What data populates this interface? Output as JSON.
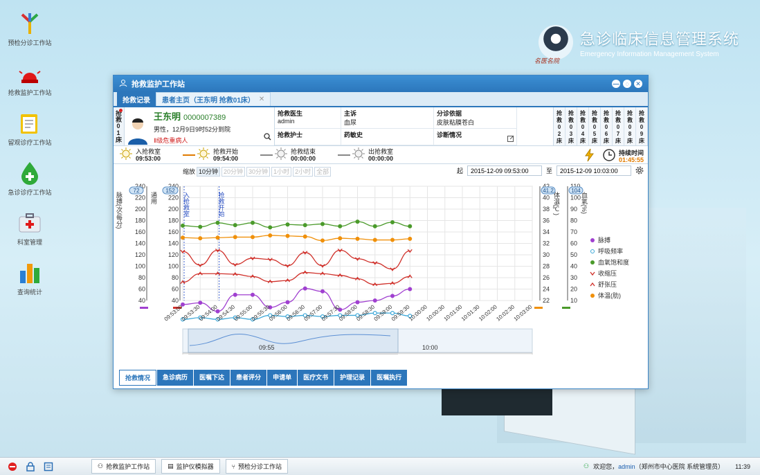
{
  "desktop": {
    "icons": [
      {
        "label": "预检分诊工作站",
        "icon": "triage-arrows-icon"
      },
      {
        "label": "抢救监护工作站",
        "icon": "alarm-light-icon"
      },
      {
        "label": "留观诊疗工作站",
        "icon": "clipboard-icon"
      },
      {
        "label": "急诊诊疗工作站",
        "icon": "drop-cross-icon"
      },
      {
        "label": "科室管理",
        "icon": "medkit-icon"
      },
      {
        "label": "查询统计",
        "icon": "bar-chart-icon"
      }
    ]
  },
  "brand": {
    "title": "急诊临床信息管理系统",
    "subtitle": "Emergency Information Management System",
    "logo_caption": "名医名院"
  },
  "window": {
    "title": "抢救监护工作站",
    "tabs": [
      {
        "label": "抢救记录",
        "active": true
      },
      {
        "label": "患者主页（王东明 抢救01床）",
        "active": false
      }
    ],
    "patient": {
      "bed_label": "抢救01床",
      "name": "王东明",
      "number": "0000007389",
      "info": "男性，12月9日9时52分到院",
      "critical": "Ⅱ级危重病人",
      "fields": [
        {
          "label": "抢救医生",
          "value": "admin"
        },
        {
          "label": "主诉",
          "value": "血尿"
        },
        {
          "label": "分诊依据",
          "value": "皮肤粘膜苍白"
        },
        {
          "label": "抢救护士",
          "value": ""
        },
        {
          "label": "药敏史",
          "value": ""
        },
        {
          "label": "诊断情况",
          "value": ""
        }
      ],
      "other_beds": [
        "抢救02床",
        "抢救03床",
        "抢救04床",
        "抢救05床",
        "抢救06床",
        "抢救07床",
        "抢救08床",
        "抢救09床"
      ]
    },
    "flow": [
      {
        "label": "入抢救室",
        "time": "09:53:00"
      },
      {
        "label": "抢救开始",
        "time": "09:54:00"
      },
      {
        "label": "抢救结束",
        "time": "00:00:00"
      },
      {
        "label": "出抢救室",
        "time": "00:00:00"
      }
    ],
    "duration": {
      "label": "持续时间",
      "value": "01:45:55"
    },
    "zoom": {
      "label": "缩放",
      "options": [
        "10分钟",
        "20分钟",
        "30分钟",
        "1小时",
        "2小时",
        "全部"
      ],
      "active": "10分钟"
    },
    "range": {
      "from_label": "起",
      "from": "2015-12-09 09:53:00",
      "to_label": "至",
      "to": "2015-12-09 10:03:00"
    },
    "bottom_tabs": [
      "抢救情况",
      "急诊病历",
      "医嘱下达",
      "患者评分",
      "申请单",
      "医疗文书",
      "护理记录",
      "医嘱执行"
    ],
    "bottom_active": "抢救情况"
  },
  "chart_data": {
    "type": "line",
    "x": [
      "09:53:00",
      "09:53:30",
      "09:54:00",
      "09:54:30",
      "09:55:00",
      "09:55:30",
      "09:56:00",
      "09:56:30",
      "09:57:00",
      "09:57:30",
      "09:58:00",
      "09:58:30",
      "09:59:00",
      "09:59:30",
      "10:00:00",
      "10:00:30",
      "10:01:00",
      "10:01:30",
      "10:02:00",
      "10:02:30",
      "10:03:00"
    ],
    "left_axis": {
      "label": "脉搏(次/每分)",
      "ticks": [
        40,
        60,
        80,
        100,
        120,
        140,
        160,
        180,
        200,
        220,
        240
      ],
      "range": [
        40,
        240
      ]
    },
    "left_axis2": {
      "label": "通用",
      "ticks": [
        40,
        60,
        80,
        100,
        120,
        140,
        160,
        180,
        200,
        220,
        240
      ],
      "range": [
        40,
        240
      ]
    },
    "right_axis": {
      "label": "体温(℃)",
      "ticks": [
        22,
        24,
        26,
        28,
        30,
        32,
        34,
        36,
        38,
        40,
        42
      ],
      "range": [
        22,
        42
      ]
    },
    "right_axis2": {
      "label": "血氧(%)",
      "ticks": [
        10,
        20,
        30,
        40,
        50,
        60,
        70,
        80,
        90,
        100,
        110
      ],
      "range": [
        10,
        110
      ]
    },
    "left_badges": [
      "72",
      "152"
    ],
    "right_badges": [
      "41.2",
      "104"
    ],
    "annotations": [
      "入抢救室",
      "抢救开始"
    ],
    "series": [
      {
        "name": "脉搏",
        "color": "#a040d0",
        "marker": "dot",
        "x_idx": [
          0,
          1,
          2,
          3,
          4,
          5,
          6,
          7,
          8,
          9,
          10,
          11,
          12,
          13
        ],
        "values": [
          33,
          36,
          21,
          50,
          50,
          28,
          37,
          61,
          56,
          24,
          37,
          40,
          48,
          60
        ]
      },
      {
        "name": "呼吸频率",
        "color": "#3ba7d8",
        "marker": "circle",
        "x_idx": [
          0,
          1,
          2,
          3,
          4,
          5,
          6,
          7,
          8,
          9,
          10,
          11,
          12,
          13
        ],
        "values": [
          7,
          10,
          7,
          10,
          7,
          14,
          12,
          14,
          12,
          14,
          14,
          18,
          18,
          13
        ]
      },
      {
        "name": "血氧饱和度",
        "color": "#4a9a2a",
        "marker": "dot",
        "x_idx": [
          0,
          1,
          2,
          3,
          4,
          5,
          6,
          7,
          8,
          9,
          10,
          11,
          12,
          13
        ],
        "values": [
          171,
          169,
          176,
          172,
          176,
          168,
          173,
          172,
          174,
          170,
          178,
          170,
          177,
          170
        ]
      },
      {
        "name": "收缩压",
        "color": "#d0302a",
        "marker": "v",
        "x_idx": [
          0,
          1,
          2,
          3,
          4,
          5,
          6,
          7,
          8,
          9,
          10,
          11,
          12,
          13
        ],
        "values": [
          126,
          102,
          128,
          103,
          114,
          112,
          101,
          124,
          101,
          128,
          113,
          106,
          95,
          127
        ]
      },
      {
        "name": "舒张压",
        "color": "#d0302a",
        "marker": "caret",
        "x_idx": [
          0,
          1,
          2,
          3,
          4,
          5,
          6,
          7,
          8,
          9,
          10,
          11,
          12,
          13
        ],
        "values": [
          72,
          87,
          87,
          86,
          82,
          73,
          75,
          89,
          87,
          84,
          78,
          68,
          70,
          82
        ]
      },
      {
        "name": "体温(肋)",
        "color": "#f0900a",
        "marker": "dot",
        "x_idx": [
          0,
          1,
          2,
          3,
          4,
          5,
          6,
          7,
          8,
          9,
          10,
          11,
          12,
          13
        ],
        "values": [
          150,
          149,
          150,
          151,
          151,
          154,
          153,
          152,
          145,
          149,
          148,
          146,
          146,
          148
        ]
      }
    ],
    "navigator": {
      "labels": [
        "09:55",
        "10:00"
      ]
    },
    "grid": true,
    "legend_position": "right"
  },
  "taskbar": {
    "buttons": [
      {
        "label": "抢救监护工作站",
        "icon": "user-icon"
      },
      {
        "label": "监护仪模拟器",
        "icon": "document-icon"
      },
      {
        "label": "预检分诊工作站",
        "icon": "triage-icon"
      }
    ],
    "welcome": "欢迎您，",
    "user": "admin",
    "org": "（郑州市中心医院 系统管理员）",
    "clock": "11:39"
  }
}
